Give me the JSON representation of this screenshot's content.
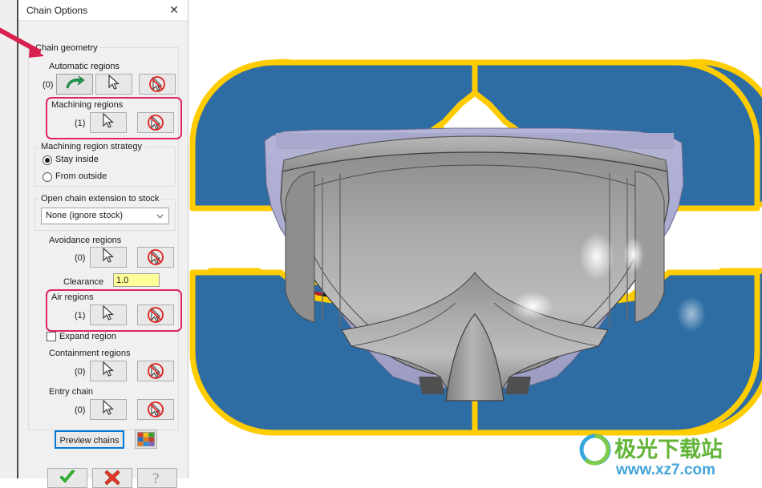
{
  "window": {
    "title": "Chain Options",
    "close_label": "✕"
  },
  "dialog": {
    "groups": {
      "chain_geometry": "Chain geometry",
      "machining_region_strategy": "Machining region strategy",
      "open_chain_extension": "Open chain extension to stock"
    },
    "sections": [
      {
        "label": "Automatic regions",
        "count": "(0)",
        "highlighted": false
      },
      {
        "label": "Machining regions",
        "count": "(1)",
        "highlighted": true
      },
      {
        "label": "Avoidance regions",
        "count": "(0)",
        "highlighted": false
      },
      {
        "label": "Air regions",
        "count": "(1)",
        "highlighted": true
      },
      {
        "label": "Containment regions",
        "count": "(0)",
        "highlighted": false
      },
      {
        "label": "Entry chain",
        "count": "(0)",
        "highlighted": false
      }
    ],
    "strategy": {
      "options": [
        "Stay inside",
        "From outside"
      ],
      "selected": "Stay inside"
    },
    "open_chain_combo": {
      "value": "None (ignore stock)",
      "options": [
        "None (ignore stock)"
      ]
    },
    "clearance": {
      "label": "Clearance",
      "value": "1.0"
    },
    "expand_region": {
      "label": "Expand region",
      "checked": false
    },
    "preview_button": "Preview chains",
    "icons": {
      "auto_region": "green-curved-arrow-icon",
      "pick": "cursor-pick-icon",
      "unpick": "cursor-deselect-icon",
      "palette": "color-palette-icon",
      "ok": "green-check-icon",
      "cancel": "red-x-icon",
      "help": "question-mark-icon"
    }
  },
  "colors": {
    "accent_highlight": "#e0245e",
    "focus_border": "#0078d7",
    "field_yellow": "#ffff99",
    "region_blue": "#2e6da4",
    "region_red": "#b3222a",
    "chain_yellow": "#ffcc00",
    "model_gray": "#9a9a9a",
    "model_lavender": "#a8a8cc",
    "dialog_bg": "#f0f0f0"
  },
  "viewport": {
    "name": "3d-model-viewport",
    "description": "Shaded 3D mold cavity part with highlighted machining chain regions"
  },
  "watermark": {
    "text": "极光下载站",
    "url": "www.xz7.com"
  }
}
